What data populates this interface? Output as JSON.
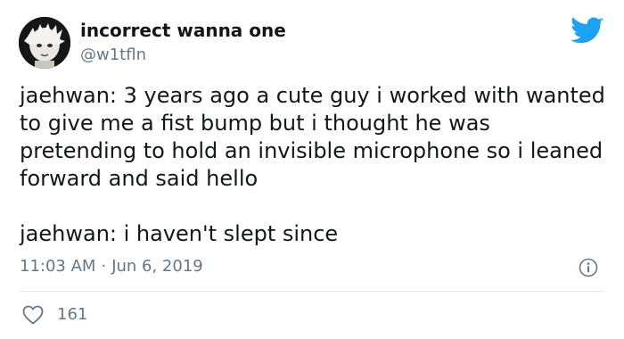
{
  "author": {
    "display_name": "incorrect wanna one",
    "handle": "@w1tfln"
  },
  "tweet": {
    "paragraphs": [
      "jaehwan: 3 years ago a cute guy i worked with wanted to give me a fist bump but i thought he was pretending to hold an invisible microphone so i leaned forward and said hello",
      "jaehwan: i haven't slept since"
    ],
    "time": "11:03 AM",
    "separator": "·",
    "date": "Jun 6, 2019",
    "likes": "161"
  },
  "colors": {
    "brand": "#1da1f2",
    "muted": "#657786",
    "text": "#14171a"
  },
  "icons": {
    "brand": "twitter-bird-icon",
    "info": "info-icon",
    "like": "heart-outline-icon"
  }
}
